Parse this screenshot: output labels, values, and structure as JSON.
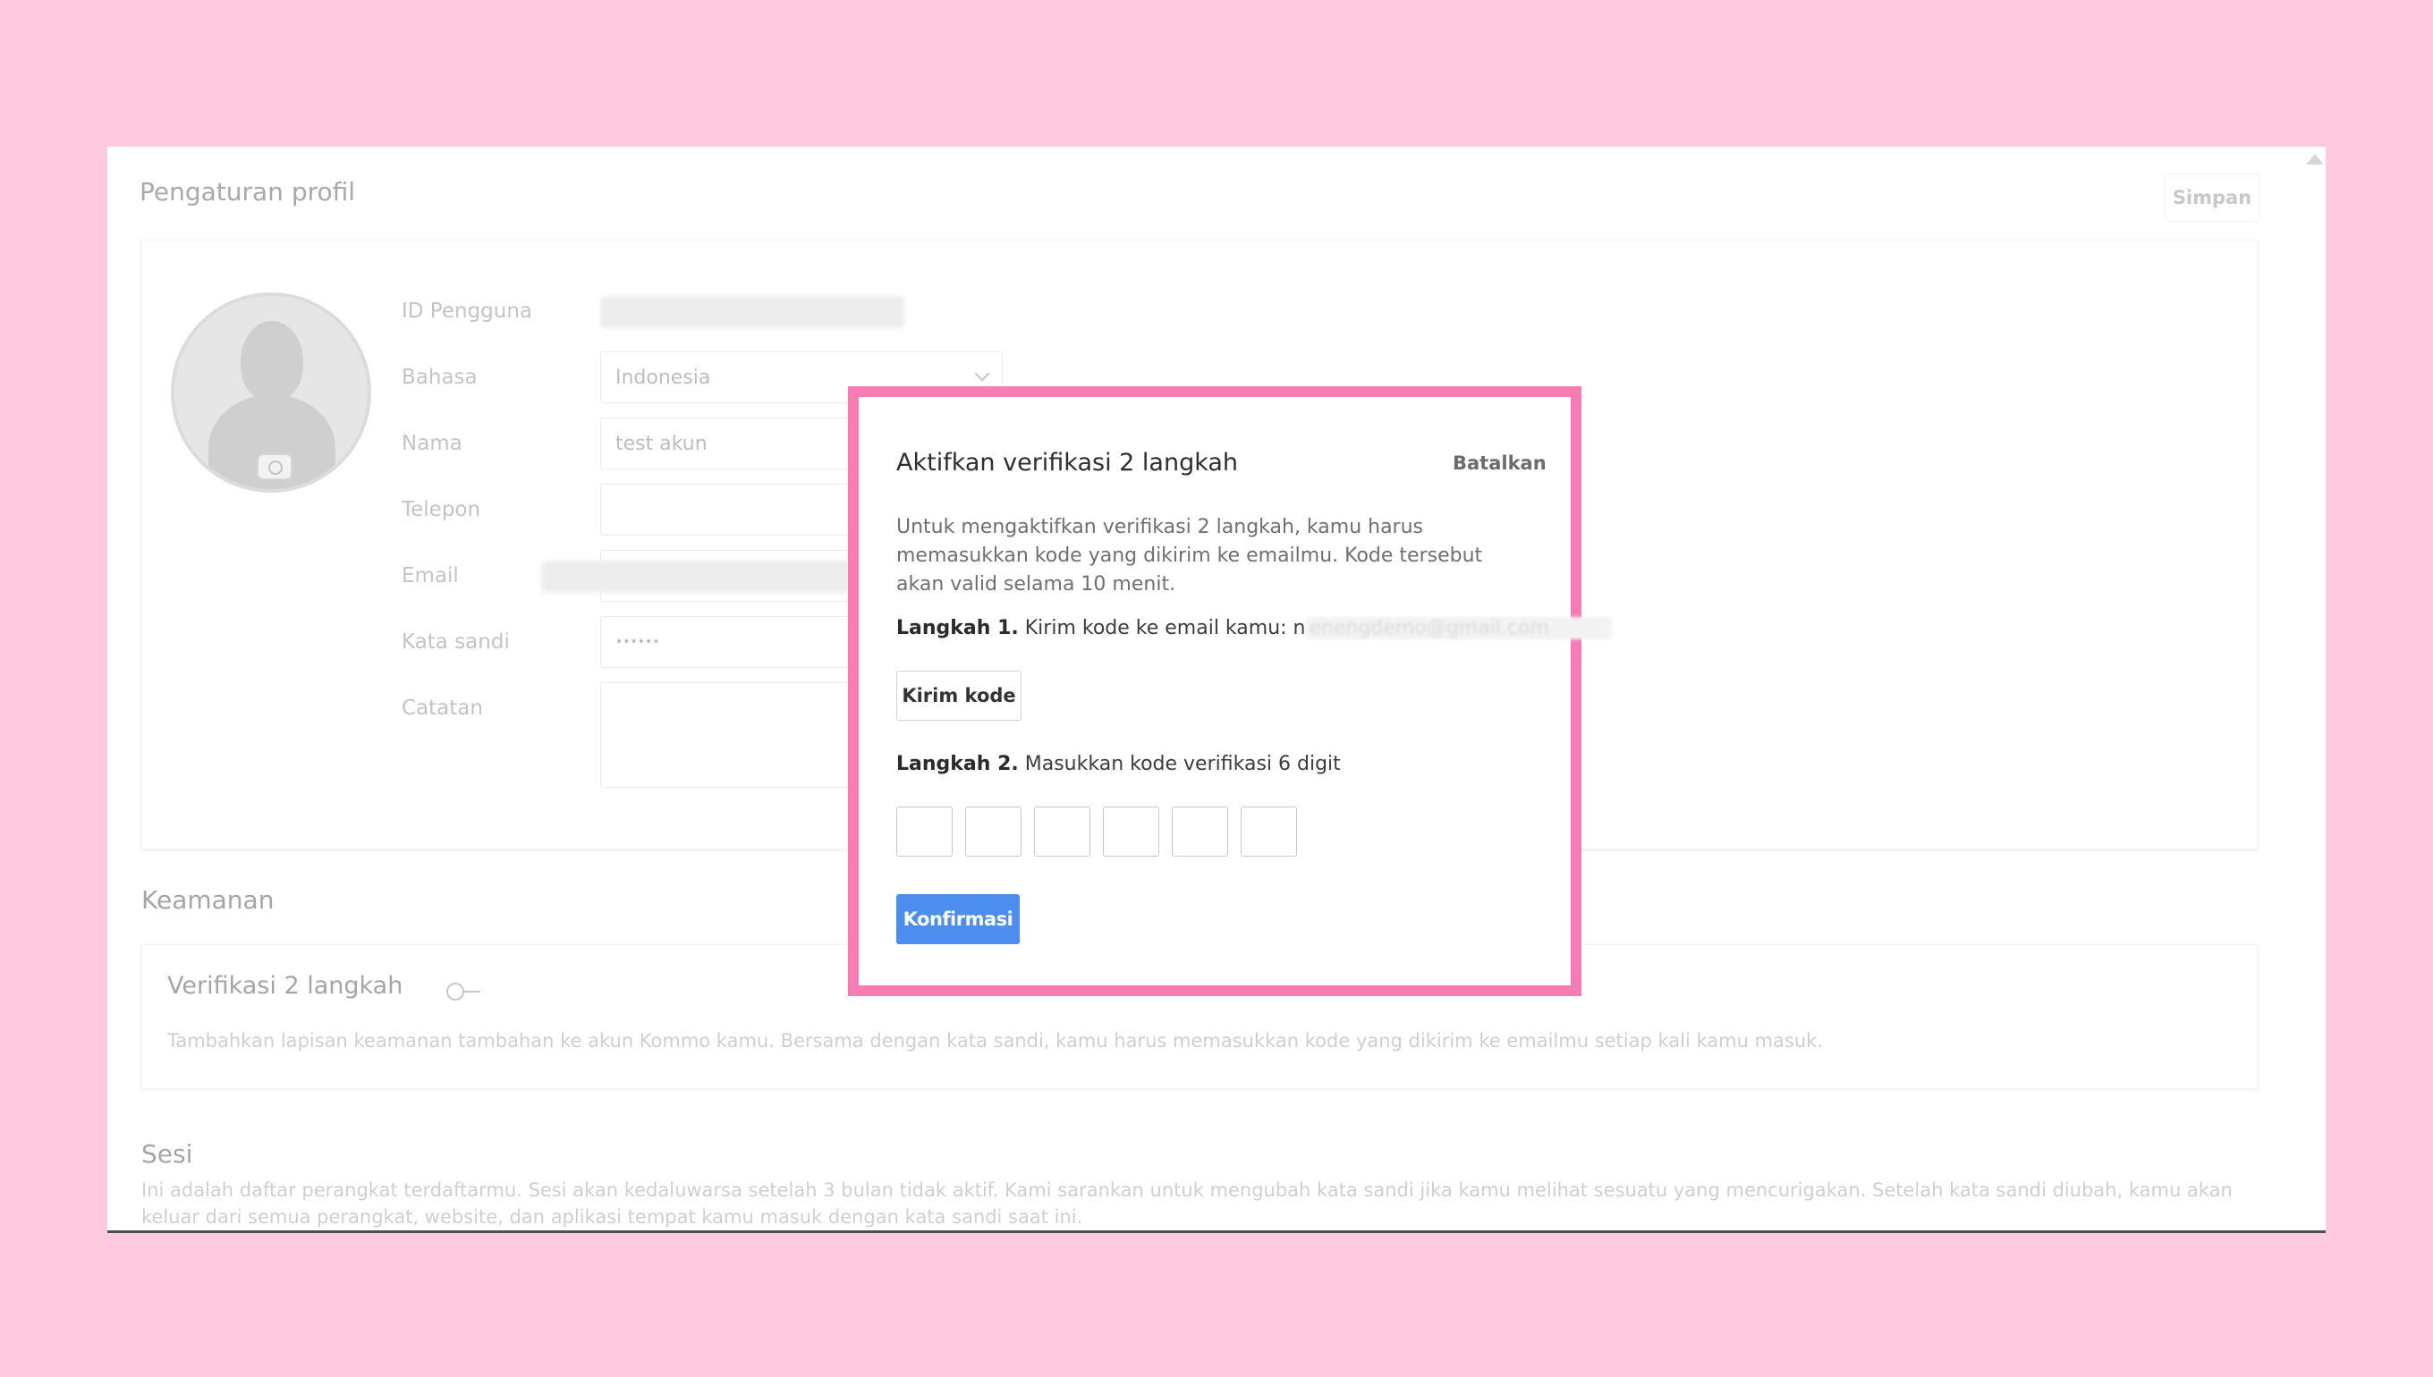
{
  "page": {
    "title": "Pengaturan profil",
    "save_label": "Simpan"
  },
  "profile": {
    "fields": {
      "user_id_label": "ID Pengguna",
      "language_label": "Bahasa",
      "language_value": "Indonesia",
      "name_label": "Nama",
      "name_value": "test akun",
      "phone_label": "Telepon",
      "phone_value": "",
      "email_label": "Email",
      "password_label": "Kata sandi",
      "password_value": "••••••",
      "notes_label": "Catatan"
    }
  },
  "security": {
    "title": "Keamanan",
    "twofa_label": "Verifikasi 2 langkah",
    "twofa_desc": "Tambahkan lapisan keamanan tambahan ke akun Kommo kamu. Bersama dengan kata sandi, kamu harus memasukkan kode yang dikirim ke emailmu setiap kali kamu masuk."
  },
  "sessions": {
    "title": "Sesi",
    "desc": "Ini adalah daftar perangkat terdaftarmu. Sesi akan kedaluwarsa setelah 3 bulan tidak aktif. Kami sarankan untuk mengubah kata sandi jika kamu melihat sesuatu yang mencurigakan. Setelah kata sandi diubah, kamu akan keluar dari semua perangkat, website, dan aplikasi tempat kamu masuk dengan kata sandi saat ini."
  },
  "modal": {
    "title": "Aktifkan verifikasi 2 langkah",
    "cancel_label": "Batalkan",
    "description": "Untuk mengaktifkan verifikasi 2 langkah, kamu harus memasukkan kode yang dikirim ke emailmu. Kode tersebut akan valid selama 10 menit.",
    "step1_prefix": "Langkah 1.",
    "step1_text": "Kirim kode ke email kamu: n",
    "step1_email": "enengdemo@gmail.com",
    "send_code_label": "Kirim kode",
    "step2_prefix": "Langkah 2.",
    "step2_text": "Masukkan kode verifikasi 6 digit",
    "confirm_label": "Konfirmasi"
  },
  "colors": {
    "background": "#ffc9df",
    "highlight_border": "#f77cb4",
    "primary_button": "#4c8ef0"
  }
}
